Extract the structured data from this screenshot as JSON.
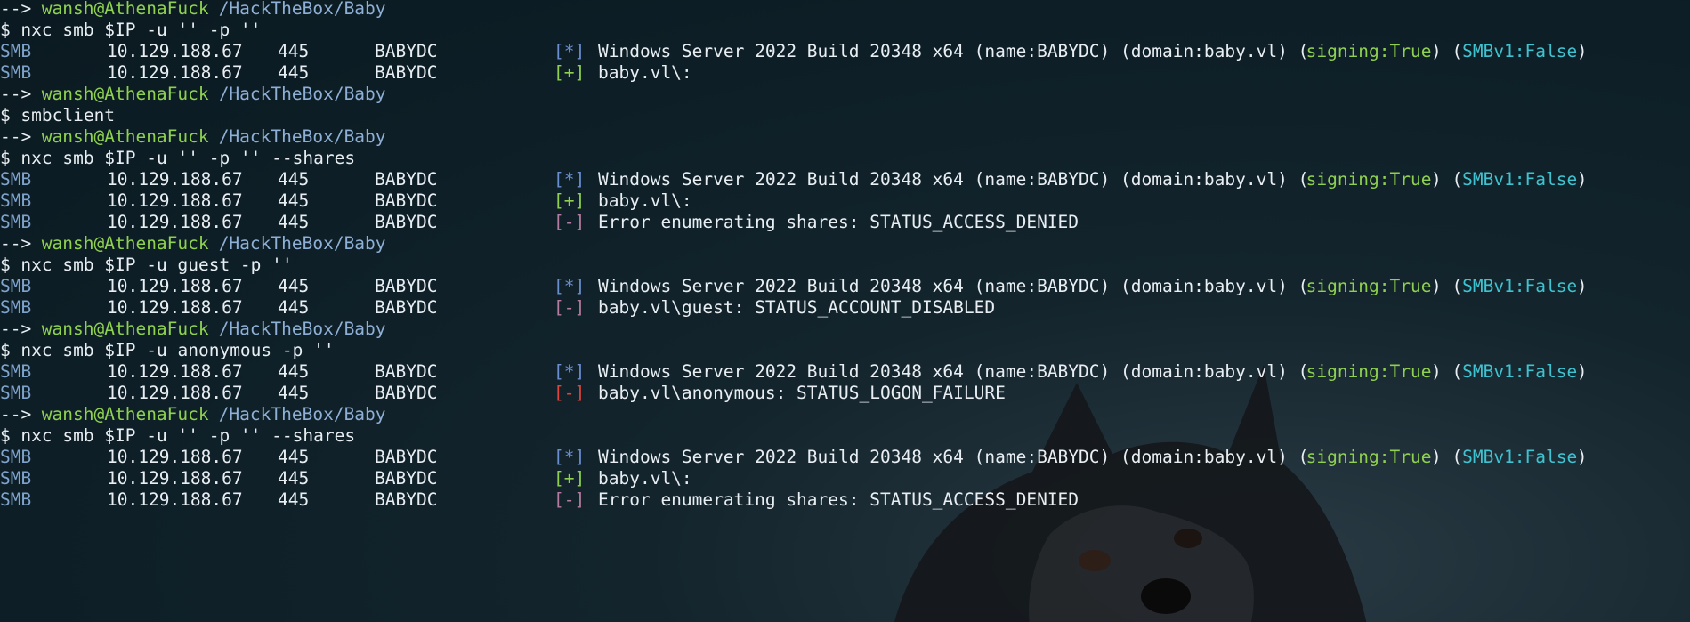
{
  "prompt": {
    "arrow": "-->",
    "user": "wansh@AthenaFuck",
    "path": "/HackTheBox/Baby",
    "dollar": "$"
  },
  "lines": [
    {
      "type": "prompt"
    },
    {
      "type": "cmd",
      "text": "nxc smb $IP -u '' -p ''"
    },
    {
      "type": "out",
      "proto": "SMB",
      "ip": "10.129.188.67",
      "port": "445",
      "host": "BABYDC",
      "tag": "[*]",
      "tagclass": "info",
      "msg": "Windows Server 2022 Build 20348 x64 (name:BABYDC) (domain:baby.vl) (",
      "signing": "signing:True",
      "mid": ") (",
      "smbv1": "SMBv1:False",
      "end": ")"
    },
    {
      "type": "out",
      "proto": "SMB",
      "ip": "10.129.188.67",
      "port": "445",
      "host": "BABYDC",
      "tag": "[+]",
      "tagclass": "ok",
      "msg": "baby.vl\\:"
    },
    {
      "type": "prompt"
    },
    {
      "type": "cmd",
      "text": "smbclient"
    },
    {
      "type": "prompt"
    },
    {
      "type": "cmd",
      "text": "nxc smb $IP -u '' -p '' --shares"
    },
    {
      "type": "out",
      "proto": "SMB",
      "ip": "10.129.188.67",
      "port": "445",
      "host": "BABYDC",
      "tag": "[*]",
      "tagclass": "info",
      "msg": "Windows Server 2022 Build 20348 x64 (name:BABYDC) (domain:baby.vl) (",
      "signing": "signing:True",
      "mid": ") (",
      "smbv1": "SMBv1:False",
      "end": ")"
    },
    {
      "type": "out",
      "proto": "SMB",
      "ip": "10.129.188.67",
      "port": "445",
      "host": "BABYDC",
      "tag": "[+]",
      "tagclass": "ok",
      "msg": "baby.vl\\:"
    },
    {
      "type": "out",
      "proto": "SMB",
      "ip": "10.129.188.67",
      "port": "445",
      "host": "BABYDC",
      "tag": "[-]",
      "tagclass": "warn",
      "msg": "Error enumerating shares: STATUS_ACCESS_DENIED"
    },
    {
      "type": "prompt"
    },
    {
      "type": "cmd",
      "text": "nxc smb $IP -u guest -p ''"
    },
    {
      "type": "out",
      "proto": "SMB",
      "ip": "10.129.188.67",
      "port": "445",
      "host": "BABYDC",
      "tag": "[*]",
      "tagclass": "info",
      "msg": "Windows Server 2022 Build 20348 x64 (name:BABYDC) (domain:baby.vl) (",
      "signing": "signing:True",
      "mid": ") (",
      "smbv1": "SMBv1:False",
      "end": ")"
    },
    {
      "type": "out",
      "proto": "SMB",
      "ip": "10.129.188.67",
      "port": "445",
      "host": "BABYDC",
      "tag": "[-]",
      "tagclass": "warn",
      "msg": "baby.vl\\guest: STATUS_ACCOUNT_DISABLED"
    },
    {
      "type": "prompt"
    },
    {
      "type": "cmd",
      "text": "nxc smb $IP -u anonymous -p ''"
    },
    {
      "type": "out",
      "proto": "SMB",
      "ip": "10.129.188.67",
      "port": "445",
      "host": "BABYDC",
      "tag": "[*]",
      "tagclass": "info",
      "msg": "Windows Server 2022 Build 20348 x64 (name:BABYDC) (domain:baby.vl) (",
      "signing": "signing:True",
      "mid": ") (",
      "smbv1": "SMBv1:False",
      "end": ")"
    },
    {
      "type": "out",
      "proto": "SMB",
      "ip": "10.129.188.67",
      "port": "445",
      "host": "BABYDC",
      "tag": "[-]",
      "tagclass": "err",
      "msg": "baby.vl\\anonymous: STATUS_LOGON_FAILURE"
    },
    {
      "type": "prompt"
    },
    {
      "type": "cmd",
      "text": "nxc smb $IP -u '' -p '' --shares"
    },
    {
      "type": "out",
      "proto": "SMB",
      "ip": "10.129.188.67",
      "port": "445",
      "host": "BABYDC",
      "tag": "[*]",
      "tagclass": "info",
      "msg": "Windows Server 2022 Build 20348 x64 (name:BABYDC) (domain:baby.vl) (",
      "signing": "signing:True",
      "mid": ") (",
      "smbv1": "SMBv1:False",
      "end": ")"
    },
    {
      "type": "out",
      "proto": "SMB",
      "ip": "10.129.188.67",
      "port": "445",
      "host": "BABYDC",
      "tag": "[+]",
      "tagclass": "ok",
      "msg": "baby.vl\\:"
    },
    {
      "type": "out",
      "proto": "SMB",
      "ip": "10.129.188.67",
      "port": "445",
      "host": "BABYDC",
      "tag": "[-]",
      "tagclass": "warn",
      "msg": "Error enumerating shares: STATUS_ACCESS_DENIED"
    }
  ]
}
